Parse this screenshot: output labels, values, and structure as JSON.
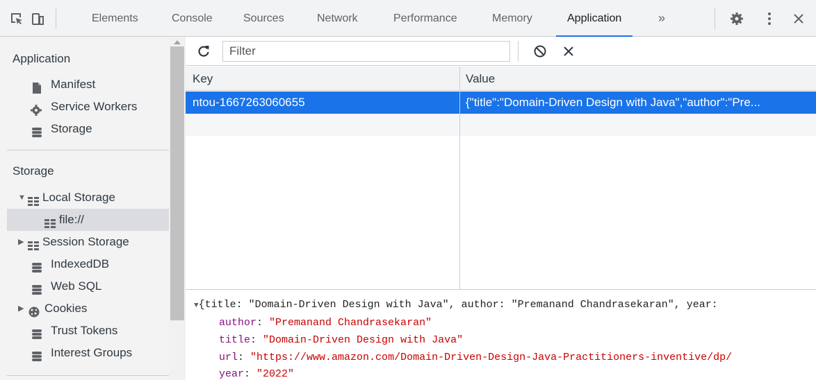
{
  "devtools": {
    "tabs": [
      "Elements",
      "Console",
      "Sources",
      "Network",
      "Performance",
      "Memory",
      "Application"
    ],
    "active_tab": "Application",
    "more_tabs": "»",
    "icons": [
      "inspect-icon",
      "device-toggle-icon",
      "settings-icon",
      "kebab-menu-icon",
      "close-icon"
    ]
  },
  "sidebar": {
    "application_heading": "Application",
    "application_items": [
      {
        "label": "Manifest",
        "icon": "document-icon"
      },
      {
        "label": "Service Workers",
        "icon": "gear-icon"
      },
      {
        "label": "Storage",
        "icon": "database-icon"
      }
    ],
    "storage_heading": "Storage",
    "storage_items": [
      {
        "label": "Local Storage",
        "icon": "table-icon",
        "expanded": true
      },
      {
        "label": "file://",
        "icon": "table-icon",
        "selected": true
      },
      {
        "label": "Session Storage",
        "icon": "table-icon",
        "expanded": false
      },
      {
        "label": "IndexedDB",
        "icon": "database-icon"
      },
      {
        "label": "Web SQL",
        "icon": "database-icon"
      },
      {
        "label": "Cookies",
        "icon": "cookie-icon",
        "expanded": false
      },
      {
        "label": "Trust Tokens",
        "icon": "database-icon"
      },
      {
        "label": "Interest Groups",
        "icon": "database-icon"
      }
    ]
  },
  "toolbar": {
    "filter_placeholder": "Filter",
    "refresh_icon": "refresh-icon",
    "clear_all_icon": "clear-all-icon",
    "delete_icon": "delete-icon"
  },
  "table": {
    "columns": [
      "Key",
      "Value"
    ],
    "rows": [
      {
        "key": "ntou-1667263060655",
        "value": "{\"title\":\"Domain-Driven Design with Java\",\"author\":\"Pre..."
      }
    ]
  },
  "preview": {
    "summary": "{title: \"Domain-Driven Design with Java\", author: \"Premanand Chandrasekaran\", year:",
    "fields": [
      {
        "key": "author",
        "value": "\"Premanand Chandrasekaran\""
      },
      {
        "key": "title",
        "value": "\"Domain-Driven Design with Java\""
      },
      {
        "key": "url",
        "value": "\"https://www.amazon.com/Domain-Driven-Design-Java-Practitioners-inventive/dp/"
      },
      {
        "key": "year",
        "value": "\"2022\""
      }
    ]
  },
  "colors": {
    "accent": "#1a73e8",
    "selected_row_text": "#ffffff",
    "preview_key": "#881280",
    "preview_string": "#c80000"
  }
}
